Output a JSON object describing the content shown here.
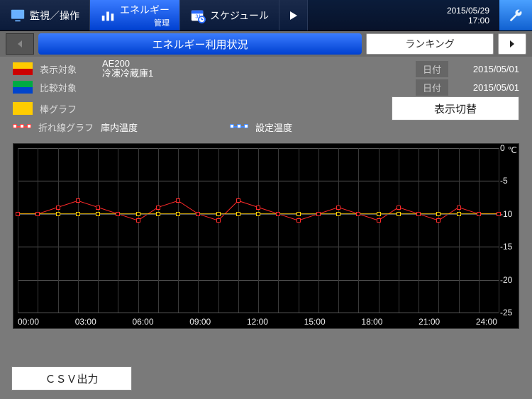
{
  "header": {
    "tab_monitor": "監視／操作",
    "tab_energy_line1": "エネルギー",
    "tab_energy_line2": "管理",
    "tab_schedule": "スケジュール",
    "date": "2015/05/29",
    "time": "17:00"
  },
  "subnav": {
    "title": "エネルギー利用状況",
    "ranking": "ランキング"
  },
  "filters": {
    "target_label": "表示対象",
    "target_value_line1": "AE200",
    "target_value_line2": "冷凍冷蔵庫1",
    "target_date_label": "日付",
    "target_date_value": "2015/05/01",
    "compare_label": "比較対象",
    "compare_date_label": "日付",
    "compare_date_value": "2015/05/01",
    "bar_label": "棒グラフ",
    "line_label": "折れ線グラフ",
    "series1": "庫内温度",
    "series2": "設定温度",
    "switch_label": "表示切替"
  },
  "buttons": {
    "csv": "ＣＳＶ出力"
  },
  "chart_data": {
    "type": "line",
    "title": "",
    "xlabel": "",
    "ylabel": "℃",
    "ylim": [
      -25,
      0
    ],
    "yticks": [
      0,
      -5,
      -10,
      -15,
      -20,
      -25
    ],
    "x": [
      0,
      1,
      2,
      3,
      4,
      5,
      6,
      7,
      8,
      9,
      10,
      11,
      12,
      13,
      14,
      15,
      16,
      17,
      18,
      19,
      20,
      21,
      22,
      23,
      24
    ],
    "xticklabels": [
      "00:00",
      "03:00",
      "06:00",
      "09:00",
      "12:00",
      "15:00",
      "18:00",
      "21:00",
      "24:00"
    ],
    "series": [
      {
        "name": "庫内温度",
        "color": "#ffcc00",
        "values": [
          -10,
          -10,
          -10,
          -10,
          -10,
          -10,
          -10,
          -10,
          -10,
          -10,
          -10,
          -10,
          -10,
          -10,
          -10,
          -10,
          -10,
          -10,
          -10,
          -10,
          -10,
          -10,
          -10,
          -10,
          -10
        ]
      },
      {
        "name": "設定温度",
        "color": "#ff2a2a",
        "values": [
          -10,
          -10,
          -9,
          -8,
          -9,
          -10,
          -11,
          -9,
          -8,
          -10,
          -11,
          -8,
          -9,
          -10,
          -11,
          -10,
          -9,
          -10,
          -11,
          -9,
          -10,
          -11,
          -9,
          -10,
          -10
        ]
      }
    ]
  }
}
